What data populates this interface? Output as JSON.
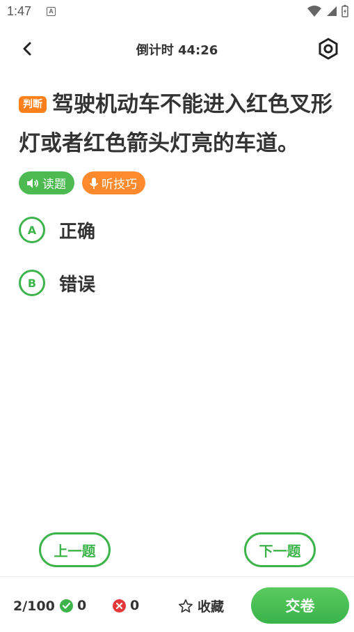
{
  "status_bar": {
    "time": "1:47",
    "notification_letter": "A"
  },
  "header": {
    "timer_text": "倒计时 44:26"
  },
  "question": {
    "type_badge": "判断",
    "text": "驾驶机动车不能进入红色叉形灯或者红色箭头灯亮的车道。"
  },
  "tools": {
    "read_label": "读题",
    "tips_label": "听技巧"
  },
  "options": [
    {
      "letter": "A",
      "text": "正确"
    },
    {
      "letter": "B",
      "text": "错误"
    }
  ],
  "nav": {
    "prev_label": "上一题",
    "next_label": "下一题"
  },
  "bottom": {
    "progress": "2/100",
    "correct_count": "0",
    "wrong_count": "0",
    "favorite_label": "收藏",
    "submit_label": "交卷"
  },
  "colors": {
    "primary_green": "#3cb44a",
    "orange": "#ff7f1a",
    "wrong_red": "#e5383b"
  }
}
